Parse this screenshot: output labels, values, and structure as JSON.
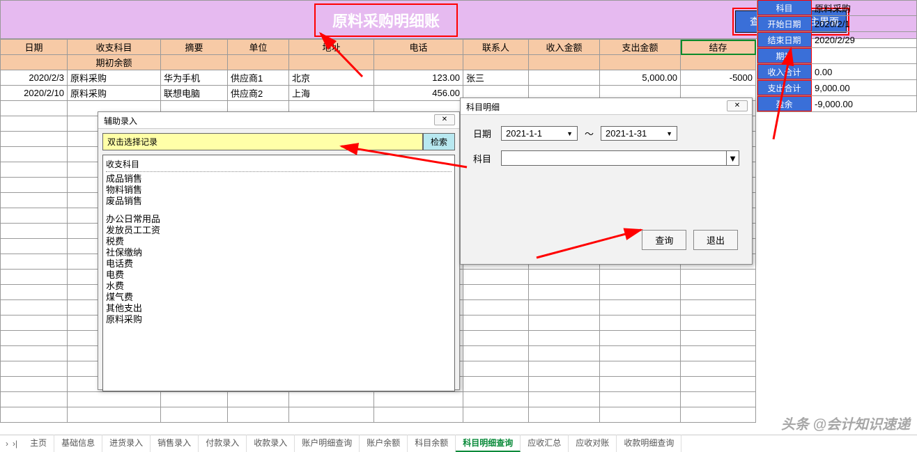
{
  "banner": {
    "title": "原料采购明细账",
    "query_btn": "查询",
    "back_btn": "返回主界面"
  },
  "columns": [
    "日期",
    "收支科目",
    "摘要",
    "单位",
    "地址",
    "电话",
    "联系人",
    "收入金额",
    "支出金额",
    "结存"
  ],
  "init_balance_label": "期初余额",
  "rows": [
    {
      "date": "2020/2/3",
      "subject": "原料采购",
      "summary": "华为手机",
      "unit": "供应商1",
      "addr": "北京",
      "phone": "123.00",
      "contact": "张三",
      "income": "",
      "expense": "5,000.00",
      "balance": "-5000"
    },
    {
      "date": "2020/2/10",
      "subject": "原料采购",
      "summary": "联想电脑",
      "unit": "供应商2",
      "addr": "上海",
      "phone": "456.00",
      "contact": "",
      "income": "",
      "expense": "",
      "balance": ""
    }
  ],
  "side": {
    "labels": {
      "subject": "科目",
      "start": "开始日期",
      "end": "结束日期",
      "init": "期初",
      "income": "收入合计",
      "expense": "支出合计",
      "surplus": "盈余"
    },
    "values": {
      "subject": "原料采购",
      "start": "2020/2/1",
      "end": "2020/2/29",
      "init": "",
      "income": "0.00",
      "expense": "9,000.00",
      "surplus": "-9,000.00"
    }
  },
  "assist": {
    "title": "辅助录入",
    "placeholder": "双击选择记录",
    "search_btn": "检索",
    "header": "收支科目",
    "group1": [
      "成品销售",
      "物料销售",
      "废品销售"
    ],
    "group2": [
      "办公日常用品",
      "发放员工工资",
      "税费",
      "社保缴纳",
      "电话费",
      "电费",
      "水费",
      "煤气费",
      "其他支出",
      "原料采购"
    ]
  },
  "detail": {
    "title": "科目明细",
    "date_label": "日期",
    "date_from": "2021-1-1",
    "date_to": "2021-1-31",
    "subject_label": "科目",
    "query_btn": "查询",
    "exit_btn": "退出"
  },
  "tabs": [
    "主页",
    "基础信息",
    "进货录入",
    "销售录入",
    "付款录入",
    "收款录入",
    "账户明细查询",
    "账户余额",
    "科目余额",
    "科目明细查询",
    "应收汇总",
    "应收对账",
    "收款明细查询"
  ],
  "active_tab": 9,
  "watermark": "头条 @会计知识速递"
}
